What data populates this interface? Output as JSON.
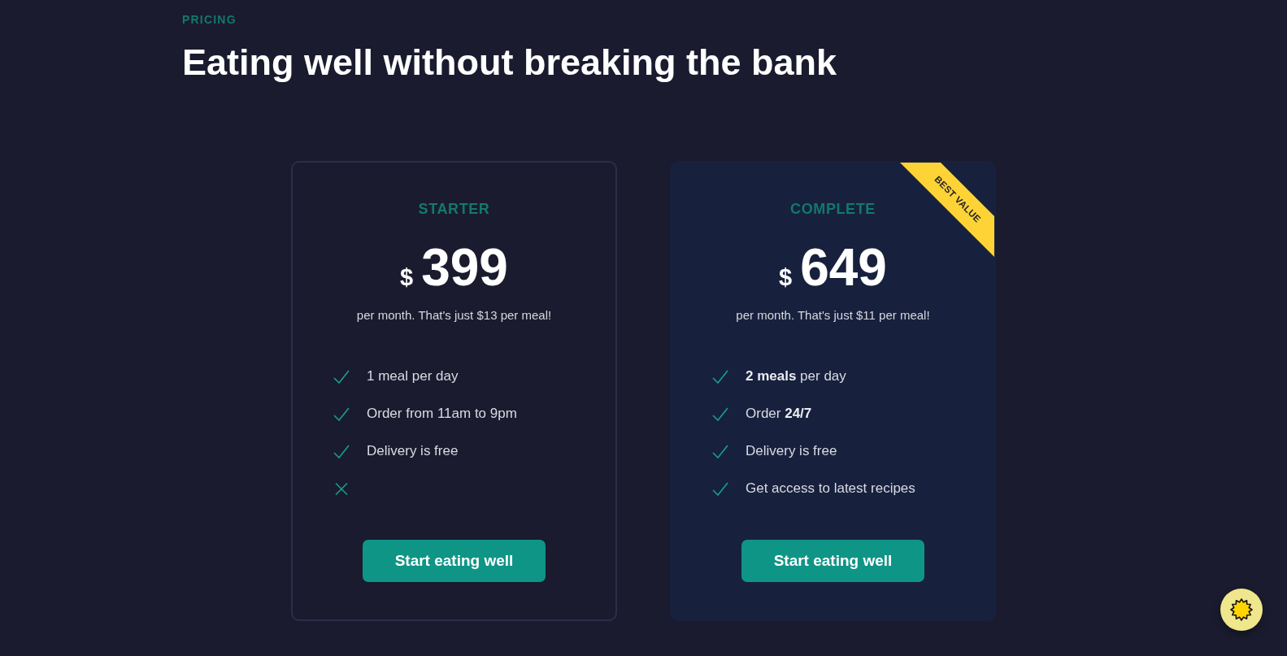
{
  "header": {
    "eyebrow": "PRICING",
    "title": "Eating well without breaking the bank"
  },
  "plans": [
    {
      "name": "STARTER",
      "featured": false,
      "currency": "$",
      "price": "399",
      "note": "per month. That's just $13 per meal!",
      "features": [
        {
          "included": true,
          "label": "1 meal per day"
        },
        {
          "included": true,
          "label": "Order from 11am to 9pm"
        },
        {
          "included": true,
          "label": "Delivery is free"
        },
        {
          "included": false
        }
      ],
      "button": "Start eating well"
    },
    {
      "name": "COMPLETE",
      "featured": true,
      "badge": "BEST VALUE",
      "currency": "$",
      "price": "649",
      "note": "per month. That's just $11 per meal!",
      "features": [
        {
          "included": true,
          "label": "**2 meals** per day"
        },
        {
          "included": true,
          "label": "Order **24/7**"
        },
        {
          "included": true,
          "label": "Delivery is free"
        },
        {
          "included": true,
          "label": "Get access to latest recipes"
        }
      ],
      "button": "Start eating well"
    }
  ]
}
